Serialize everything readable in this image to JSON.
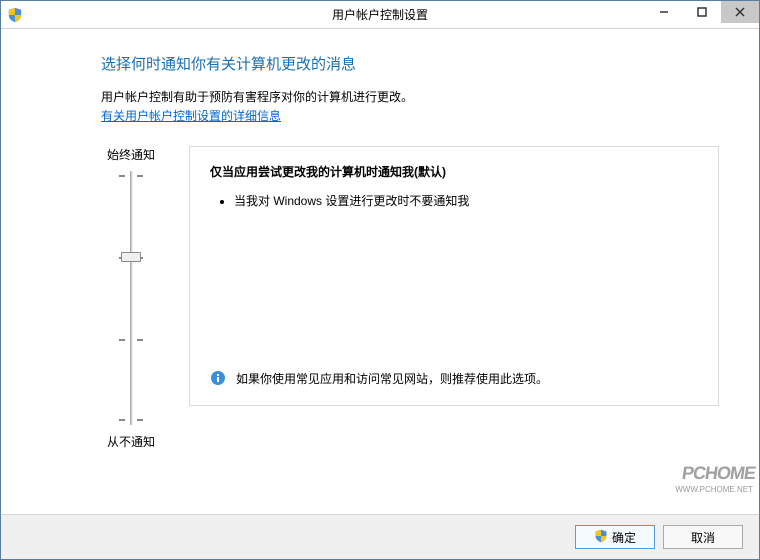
{
  "window": {
    "title": "用户帐户控制设置"
  },
  "content": {
    "heading": "选择何时通知你有关计算机更改的消息",
    "description": "用户帐户控制有助于预防有害程序对你的计算机进行更改。",
    "link": "有关用户帐户控制设置的详细信息"
  },
  "slider": {
    "topLabel": "始终通知",
    "bottomLabel": "从不通知",
    "levels": 4,
    "currentLevel": 2
  },
  "infoBox": {
    "title": "仅当应用尝试更改我的计算机时通知我(默认)",
    "bullets": [
      "当我对 Windows 设置进行更改时不要通知我"
    ],
    "recommendation": "如果你使用常见应用和访问常见网站，则推荐使用此选项。"
  },
  "footer": {
    "ok": "确定",
    "cancel": "取消"
  },
  "watermark": {
    "main": "PCHOME",
    "sub": "WWW.PCHOME.NET"
  }
}
